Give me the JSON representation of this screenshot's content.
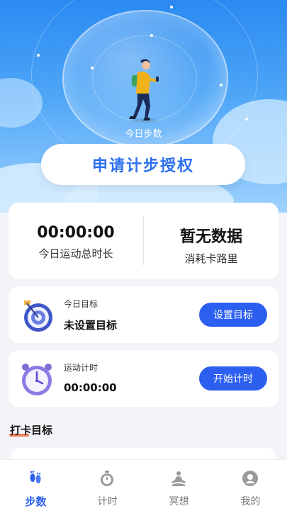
{
  "hero": {
    "caption": "今日步数",
    "auth_button": "申请计步授权"
  },
  "stats": {
    "duration_value": "00:00:00",
    "duration_label": "今日运动总时长",
    "calories_value": "暂无数据",
    "calories_label": "消耗卡路里"
  },
  "goal": {
    "title": "今日目标",
    "value": "未设置目标",
    "button": "设置目标",
    "icon": "target-icon"
  },
  "timer": {
    "title": "运动计时",
    "value": "00:00:00",
    "button": "开始计时",
    "icon": "clock-icon"
  },
  "checkin": {
    "title": "打卡目标"
  },
  "tabs": [
    {
      "label": "步数",
      "icon": "footprints-icon",
      "active": true
    },
    {
      "label": "计时",
      "icon": "stopwatch-icon",
      "active": false
    },
    {
      "label": "冥想",
      "icon": "meditation-icon",
      "active": false
    },
    {
      "label": "我的",
      "icon": "user-icon",
      "active": false
    }
  ],
  "colors": {
    "accent": "#2c5ff0",
    "hero_top": "#2a8af1",
    "hero_bottom": "#9fd2ff",
    "checkin_underline": "#f06a3a"
  }
}
